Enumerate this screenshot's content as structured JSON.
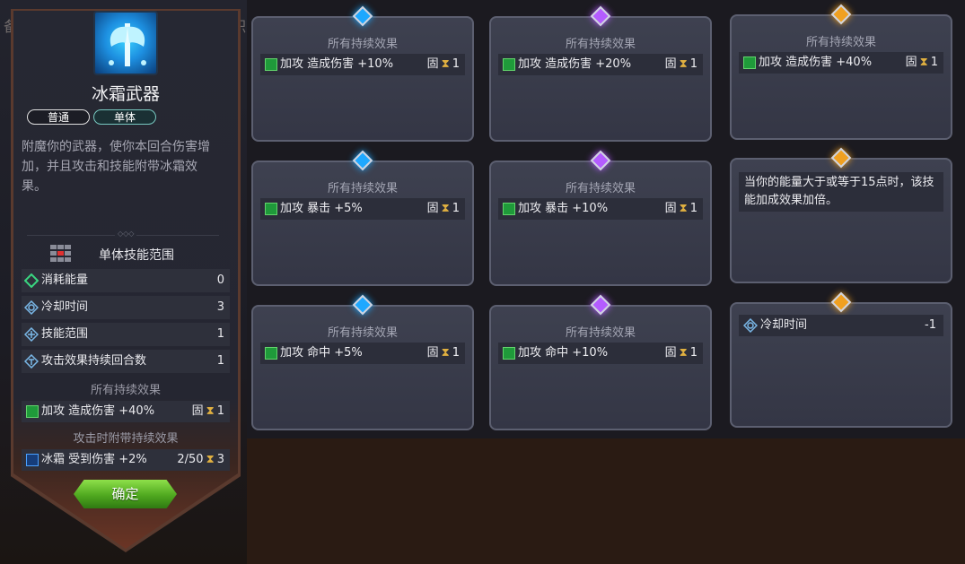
{
  "background_text": {
    "left_char": "备",
    "right_char": "职"
  },
  "skill": {
    "name": "冰霜武器",
    "tags": [
      "普通",
      "单体"
    ],
    "description": "附魔你的武器，使你本回合伤害增加，并且攻击和技能附带冰霜效果。",
    "range_label": "单体技能范围",
    "stats": [
      {
        "label": "消耗能量",
        "value": "0",
        "icon": "diamond-energy-icon"
      },
      {
        "label": "冷却时间",
        "value": "3",
        "icon": "cooldown-icon"
      },
      {
        "label": "技能范围",
        "value": "1",
        "icon": "range-icon"
      },
      {
        "label": "攻击效果持续回合数",
        "value": "1",
        "icon": "duration-icon"
      }
    ],
    "persistent_header": "所有持续效果",
    "persistent_effect": {
      "label": "加攻 造成伤害 +40%",
      "fixed": "固",
      "turns": "1"
    },
    "on_attack_header": "攻击时附带持续效果",
    "on_attack_effect": {
      "label": "冰霜 受到伤害 +2%",
      "stacks": "2/50",
      "turns": "3"
    },
    "confirm_label": "确定"
  },
  "cards": [
    {
      "header": "所有持续效果",
      "effect": "加攻 造成伤害 +10%",
      "fixed": "固",
      "turns": "1",
      "gem": "blue"
    },
    {
      "header": "所有持续效果",
      "effect": "加攻 造成伤害 +20%",
      "fixed": "固",
      "turns": "1",
      "gem": "purple"
    },
    {
      "header": "所有持续效果",
      "effect": "加攻 造成伤害 +40%",
      "fixed": "固",
      "turns": "1",
      "gem": "gold"
    },
    {
      "header": "所有持续效果",
      "effect": "加攻 暴击 +5%",
      "fixed": "固",
      "turns": "1",
      "gem": "blue"
    },
    {
      "header": "所有持续效果",
      "effect": "加攻 暴击 +10%",
      "fixed": "固",
      "turns": "1",
      "gem": "purple"
    },
    {
      "text": "当你的能量大于或等于15点时，该技能加成效果加倍。",
      "gem": "gold"
    },
    {
      "header": "所有持续效果",
      "effect": "加攻 命中 +5%",
      "fixed": "固",
      "turns": "1",
      "gem": "blue"
    },
    {
      "header": "所有持续效果",
      "effect": "加攻 命中 +10%",
      "fixed": "固",
      "turns": "1",
      "gem": "purple"
    },
    {
      "detail_label": "冷却时间",
      "detail_value": "-1",
      "gem": "gold"
    }
  ],
  "colors": {
    "gem_blue": "#1ea8ff",
    "gem_purple": "#b45cff",
    "gem_gold": "#f0a020",
    "confirm_green": "#4fa81f"
  }
}
